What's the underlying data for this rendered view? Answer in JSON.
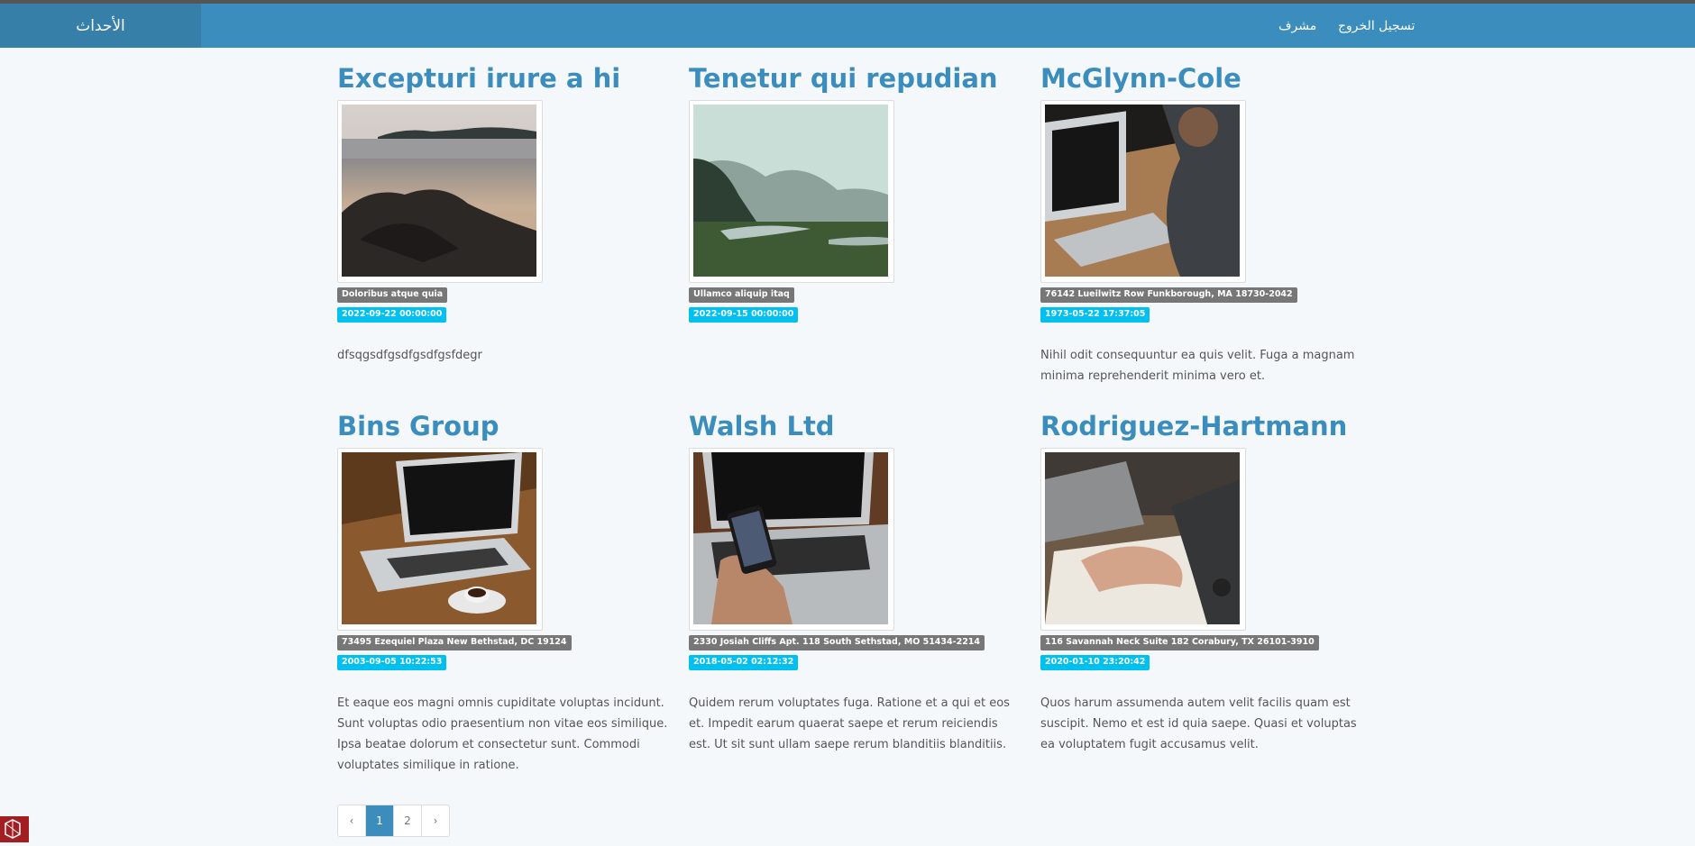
{
  "nav": {
    "brand": "الأحداث",
    "logout": "تسجيل الخروج",
    "admin": "مشرف"
  },
  "events": [
    {
      "title": "Excepturi irure a hi",
      "location": "Doloribus atque quia",
      "date": "2022-09-22 00:00:00",
      "description": "dfsqgsdfgsdfgsdfgsfdegr",
      "image": "beach-rocks-photo"
    },
    {
      "title": "Tenetur qui repudian",
      "location": "Ullamco aliquip itaq",
      "date": "2022-09-15 00:00:00",
      "description": "",
      "image": "river-valley-photo"
    },
    {
      "title": "McGlynn-Cole",
      "location": "76142 Lueilwitz Row Funkborough, MA 18730-2042",
      "date": "1973-05-22 17:37:05",
      "description": "Nihil odit consequuntur ea quis velit. Fuga a magnam minima reprehenderit minima vero et.",
      "image": "laptop-person-photo"
    },
    {
      "title": "Bins Group",
      "location": "73495 Ezequiel Plaza New Bethstad, DC 19124",
      "date": "2003-09-05 10:22:53",
      "description": "Et eaque eos magni omnis cupiditate voluptas incidunt. Sunt voluptas odio praesentium non vitae eos similique. Ipsa beatae dolorum et consectetur sunt. Commodi voluptates similique in ratione.",
      "image": "laptop-coffee-photo"
    },
    {
      "title": "Walsh Ltd",
      "location": "2330 Josiah Cliffs Apt. 118 South Sethstad, MO 51434-2214",
      "date": "2018-05-02 02:12:32",
      "description": "Quidem rerum voluptates fuga. Ratione et a qui et eos et. Impedit earum quaerat saepe et rerum reiciendis est. Ut sit sunt ullam saepe rerum blanditiis blanditiis.",
      "image": "phone-laptop-photo"
    },
    {
      "title": "Rodriguez-Hartmann",
      "location": "116 Savannah Neck Suite 182 Corabury, TX 26101-3910",
      "date": "2020-01-10 23:20:42",
      "description": "Quos harum assumenda autem velit facilis quam est suscipit. Nemo et est id quia saepe. Quasi et voluptas ea voluptatem fugit accusamus velit.",
      "image": "writing-notebook-photo"
    }
  ],
  "pagination": {
    "prev": "‹",
    "pages": [
      "1",
      "2"
    ],
    "next": "›",
    "current": "1"
  },
  "colors": {
    "navbar": "#3b8dbd",
    "brand_bg": "#367fa9",
    "title": "#3b8dbd",
    "badge_gray": "#777777",
    "badge_blue": "#00c0ef",
    "page_active": "#3c8dbc"
  }
}
